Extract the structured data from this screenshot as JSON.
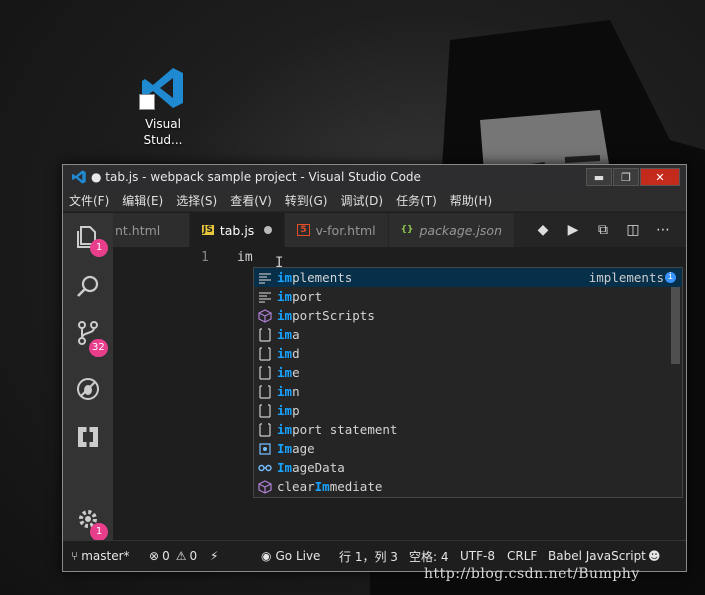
{
  "desktop": {
    "icon_label_line1": "Visual",
    "icon_label_line2": "Stud...",
    "watermark": "http://blog.csdn.net/Bumphy"
  },
  "window": {
    "title": "● tab.js - webpack sample project - Visual Studio Code",
    "controls": {
      "minimize": "▬",
      "maximize": "❐",
      "close": "✕"
    }
  },
  "menu": [
    "文件(F)",
    "编辑(E)",
    "选择(S)",
    "查看(V)",
    "转到(G)",
    "调试(D)",
    "任务(T)",
    "帮助(H)"
  ],
  "activity_badges": {
    "explorer": "1",
    "source_control": "32",
    "settings": "1"
  },
  "tabs": [
    {
      "name": "nt.html",
      "icon": "",
      "active": false
    },
    {
      "name": "tab.js",
      "icon": "JS",
      "active": true,
      "dirty": true
    },
    {
      "name": "v-for.html",
      "icon": "5",
      "active": false
    },
    {
      "name": "package.json",
      "icon": "{}",
      "active": false
    }
  ],
  "editor": {
    "line_number": "1",
    "text": "im"
  },
  "suggestions": [
    {
      "pre": "",
      "hl": "im",
      "post": "plements",
      "kind": "keyword",
      "detail": "implements"
    },
    {
      "pre": "",
      "hl": "im",
      "post": "port",
      "kind": "keyword"
    },
    {
      "pre": "",
      "hl": "im",
      "post": "portScripts",
      "kind": "method"
    },
    {
      "pre": "",
      "hl": "im",
      "post": "a",
      "kind": "snippet"
    },
    {
      "pre": "",
      "hl": "im",
      "post": "d",
      "kind": "snippet"
    },
    {
      "pre": "",
      "hl": "im",
      "post": "e",
      "kind": "snippet"
    },
    {
      "pre": "",
      "hl": "im",
      "post": "n",
      "kind": "snippet"
    },
    {
      "pre": "",
      "hl": "im",
      "post": "p",
      "kind": "snippet"
    },
    {
      "pre": "",
      "hl": "im",
      "post": "port statement",
      "kind": "snippet"
    },
    {
      "pre": "",
      "hl": "Im",
      "post": "age",
      "kind": "class"
    },
    {
      "pre": "",
      "hl": "Im",
      "post": "ageData",
      "kind": "interface"
    },
    {
      "pre": "clear",
      "hl": "Im",
      "post": "mediate",
      "kind": "method"
    }
  ],
  "statusbar": {
    "branch": "master*",
    "errors": "0",
    "warnings": "0",
    "go_live": "Go Live",
    "position": "行 1，列 3",
    "spaces": "空格: 4",
    "encoding": "UTF-8",
    "eol": "CRLF",
    "language": "Babel JavaScript"
  },
  "colors": {
    "accent": "#007acc",
    "badge": "#e83e8c",
    "match_highlight": "#18a3ff",
    "js_icon": "#e8c83a",
    "html_icon": "#e44d26",
    "json_icon": "#8bc34a"
  }
}
